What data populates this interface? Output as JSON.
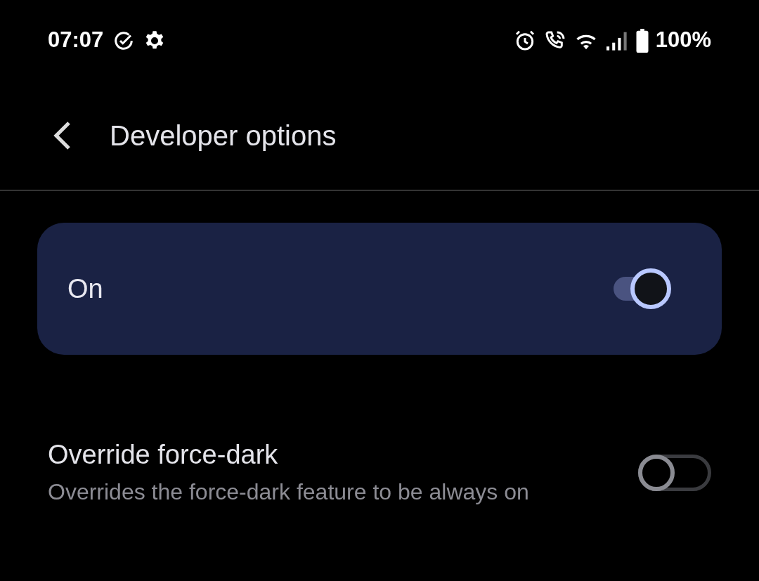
{
  "status_bar": {
    "time": "07:07",
    "battery": "100%"
  },
  "header": {
    "title": "Developer options"
  },
  "main_switch": {
    "label": "On",
    "on": true
  },
  "settings": [
    {
      "title": "Override force-dark",
      "subtitle": "Overrides the force-dark feature to be always on",
      "on": false
    }
  ]
}
